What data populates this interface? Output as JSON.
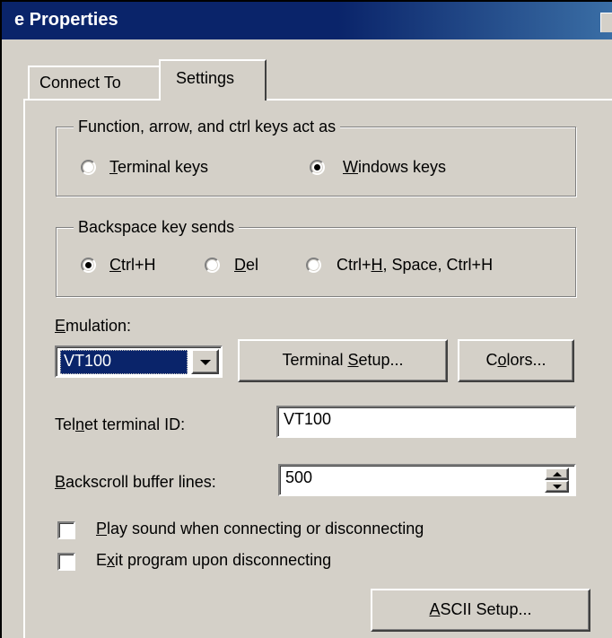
{
  "window": {
    "title": "e Properties"
  },
  "tabs": [
    {
      "label": "Connect To"
    },
    {
      "label": "Settings"
    }
  ],
  "function_keys": {
    "legend": "Function, arrow, and ctrl keys act as",
    "options": [
      {
        "mnemonic": "T",
        "rest": "erminal keys",
        "selected": false
      },
      {
        "mnemonic": "W",
        "rest": "indows keys",
        "selected": true
      }
    ]
  },
  "backspace": {
    "legend": "Backspace key sends",
    "options": [
      {
        "pre": "",
        "mnemonic": "C",
        "rest": "trl+H",
        "selected": true
      },
      {
        "pre": "",
        "mnemonic": "D",
        "rest": "el",
        "selected": false
      },
      {
        "pre": "Ctrl+",
        "mnemonic": "H",
        "rest": ", Space, Ctrl+H",
        "selected": false
      }
    ]
  },
  "emulation": {
    "label_mnemonic": "E",
    "label_rest": "mulation:",
    "value": "VT100",
    "setup_pre": "Terminal ",
    "setup_mnemonic": "S",
    "setup_rest": "etup...",
    "colors_pre": "C",
    "colors_mnemonic": "o",
    "colors_rest": "lors..."
  },
  "telnet_id": {
    "label_pre": "Tel",
    "label_mnemonic": "n",
    "label_rest": "et terminal ID:",
    "value": "VT100"
  },
  "backscroll": {
    "label_mnemonic": "B",
    "label_rest": "ackscroll buffer lines:",
    "value": "500"
  },
  "checkboxes": [
    {
      "pre": "",
      "mnemonic": "P",
      "rest": "lay sound when connecting or disconnecting",
      "checked": false
    },
    {
      "pre": "E",
      "mnemonic": "x",
      "rest": "it program upon disconnecting",
      "checked": false
    }
  ],
  "ascii_button": {
    "mnemonic": "A",
    "rest": "SCII Setup..."
  }
}
